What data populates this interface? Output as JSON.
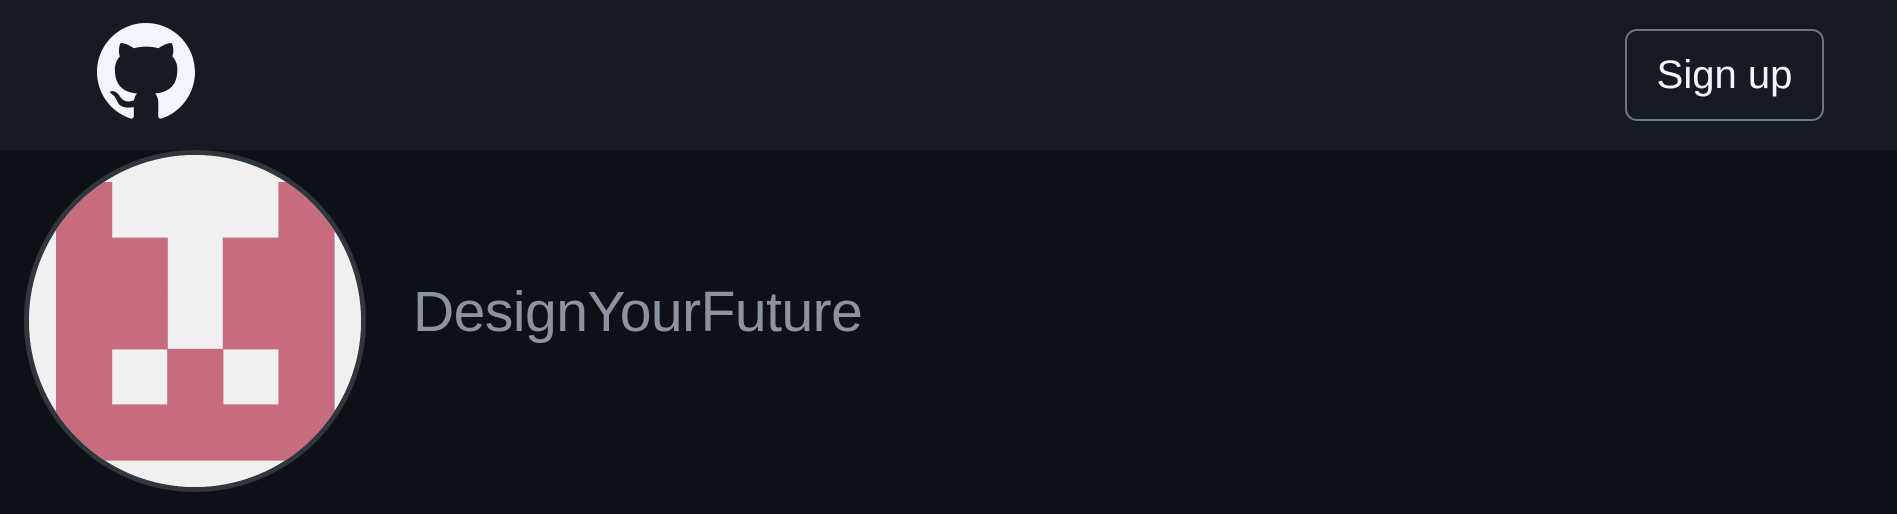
{
  "header": {
    "logo_icon": "github-octocat-icon",
    "signup_label": "Sign up"
  },
  "profile": {
    "username": "DesignYourFuture",
    "avatar": {
      "type": "identicon",
      "foreground": "#c76b7e",
      "background": "#f0f0f0"
    }
  },
  "colors": {
    "page_background": "#0d1117",
    "header_background": "#161b22",
    "button_border": "#6e7681",
    "username_text": "#8b949e"
  }
}
